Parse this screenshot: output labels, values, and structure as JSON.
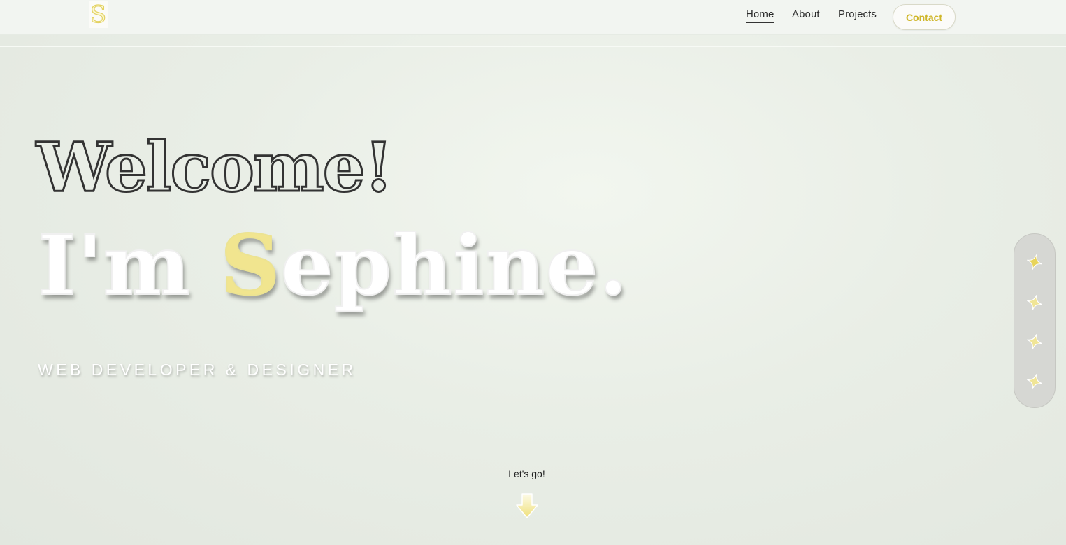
{
  "header": {
    "logo_letter": "S",
    "nav": [
      {
        "label": "Home",
        "active": true
      },
      {
        "label": "About",
        "active": false
      },
      {
        "label": "Projects",
        "active": false
      }
    ],
    "contact_label": "Contact"
  },
  "hero": {
    "greeting": "Welcome!",
    "intro_prefix": "I'm ",
    "intro_highlight": "S",
    "intro_rest": "ephine.",
    "subtitle": "WEB DEVELOPER & DESIGNER"
  },
  "side_nav": {
    "items": [
      {
        "icon": "sparkle-icon",
        "active": true
      },
      {
        "icon": "sparkle-icon",
        "active": false
      },
      {
        "icon": "sparkle-icon",
        "active": false
      },
      {
        "icon": "sparkle-icon",
        "active": false
      }
    ]
  },
  "scroll_cta": {
    "label": "Let's go!",
    "icon": "arrow-down-icon"
  },
  "colors": {
    "accent": "#f1e58f",
    "accent_dark": "#cfb62a",
    "text_dark": "#333333",
    "background": "#e9eee6"
  }
}
